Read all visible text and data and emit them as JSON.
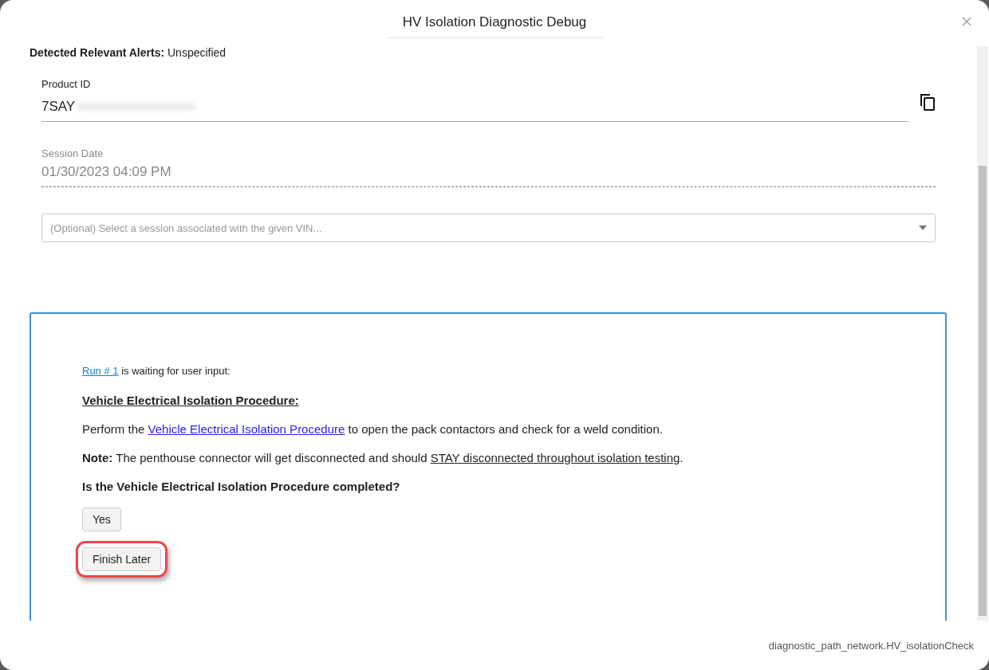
{
  "window": {
    "title": "HV Isolation Diagnostic Debug"
  },
  "alerts": {
    "label": "Detected Relevant Alerts:",
    "value": "Unspecified"
  },
  "product_id": {
    "label": "Product ID",
    "value": "7SAY"
  },
  "session_date": {
    "label": "Session Date",
    "value": "01/30/2023 04:09 PM",
    "disabled": true
  },
  "session_select": {
    "placeholder": "(Optional) Select a session associated with the given VIN..."
  },
  "run_panel": {
    "run_link": "Run # 1",
    "status": "is waiting for user input:",
    "heading": "Vehicle Electrical Isolation Procedure:",
    "instruction": {
      "before": "Perform the ",
      "link": "Vehicle Electrical Isolation Procedure",
      "after": " to open the pack contactors and check for a weld condition."
    },
    "note": {
      "lead": "**Note:** The penthouse connector will get disconnected and should ",
      "underlined": "STAY disconnected throughout isolation testing",
      "end": "."
    },
    "question": "Is the Vehicle Electrical Isolation Procedure completed?",
    "buttons": [
      {
        "label": "Yes",
        "highlighted": false
      },
      {
        "label": "Finish Later",
        "highlighted": true
      }
    ]
  },
  "footer": "diagnostic_path_network.HV_isolationCheck"
}
